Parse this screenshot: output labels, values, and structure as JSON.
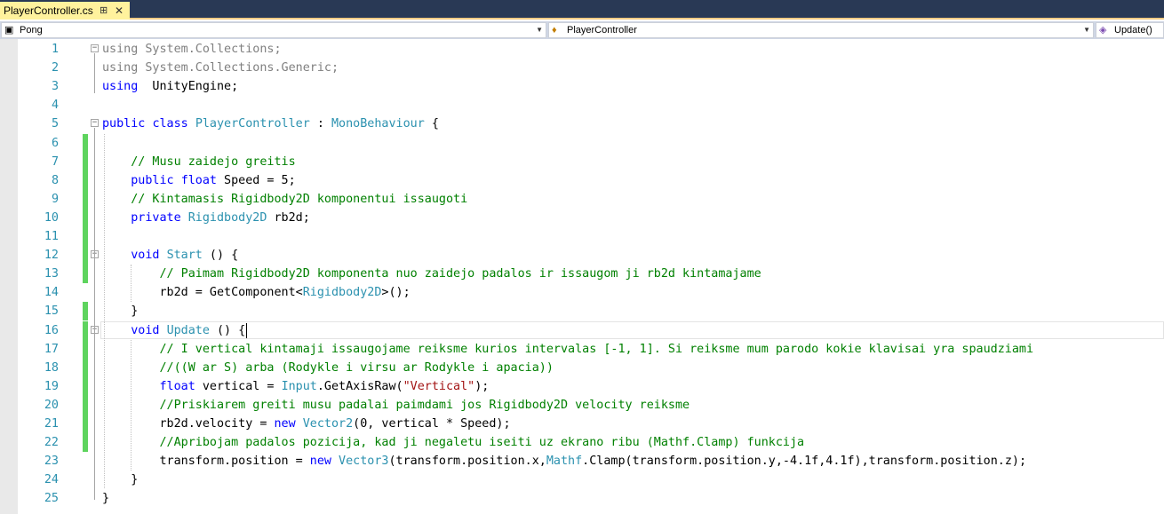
{
  "tab": {
    "title": "PlayerController.cs",
    "pin_icon": "pin-icon",
    "close_icon": "close-icon"
  },
  "nav": {
    "project": "Pong",
    "class": "PlayerController",
    "member": "Update()"
  },
  "editor": {
    "caret_line": 16,
    "lines": [
      {
        "n": "1",
        "t": [
          [
            "gray",
            "using System.Collections;"
          ]
        ],
        "collapse": "-"
      },
      {
        "n": "2",
        "t": [
          [
            "gray",
            "using System.Collections.Generic;"
          ]
        ]
      },
      {
        "n": "3",
        "t": [
          [
            "kw",
            "using"
          ],
          [
            "",
            "  UnityEngine;"
          ]
        ]
      },
      {
        "n": "4",
        "t": []
      },
      {
        "n": "5",
        "t": [
          [
            "kw",
            "public"
          ],
          [
            "",
            " "
          ],
          [
            "kw",
            "class"
          ],
          [
            "",
            " "
          ],
          [
            "ty",
            "PlayerController"
          ],
          [
            "",
            " : "
          ],
          [
            "ty",
            "MonoBehaviour"
          ],
          [
            "",
            " {"
          ]
        ],
        "collapse": "-"
      },
      {
        "n": "6",
        "t": [],
        "changed": true
      },
      {
        "n": "7",
        "t": [
          [
            "",
            "    "
          ],
          [
            "cm",
            "// Musu zaidejo greitis"
          ]
        ],
        "changed": true
      },
      {
        "n": "8",
        "t": [
          [
            "",
            "    "
          ],
          [
            "kw",
            "public"
          ],
          [
            "",
            " "
          ],
          [
            "kw",
            "float"
          ],
          [
            "",
            " Speed = 5;"
          ]
        ],
        "changed": true
      },
      {
        "n": "9",
        "t": [
          [
            "",
            "    "
          ],
          [
            "cm",
            "// Kintamasis Rigidbody2D komponentui issaugoti"
          ]
        ],
        "changed": true
      },
      {
        "n": "10",
        "t": [
          [
            "",
            "    "
          ],
          [
            "kw",
            "private"
          ],
          [
            "",
            " "
          ],
          [
            "ty",
            "Rigidbody2D"
          ],
          [
            "",
            " rb2d;"
          ]
        ],
        "changed": true
      },
      {
        "n": "11",
        "t": [],
        "changed": true
      },
      {
        "n": "12",
        "t": [
          [
            "",
            "    "
          ],
          [
            "kw",
            "void"
          ],
          [
            "",
            " "
          ],
          [
            "ty",
            "Start"
          ],
          [
            "",
            " () {"
          ]
        ],
        "changed": true,
        "collapse": "-"
      },
      {
        "n": "13",
        "t": [
          [
            "",
            "        "
          ],
          [
            "cm",
            "// Paimam Rigidbody2D komponenta nuo zaidejo padalos ir issaugom ji rb2d kintamajame"
          ]
        ],
        "changed": true
      },
      {
        "n": "14",
        "t": [
          [
            "",
            "        rb2d = GetComponent<"
          ],
          [
            "ty",
            "Rigidbody2D"
          ],
          [
            "",
            ">();"
          ]
        ]
      },
      {
        "n": "15",
        "t": [
          [
            "",
            "    }"
          ]
        ],
        "changed": true
      },
      {
        "n": "16",
        "t": [
          [
            "",
            "    "
          ],
          [
            "kw",
            "void"
          ],
          [
            "",
            " "
          ],
          [
            "ty",
            "Update"
          ],
          [
            "",
            " () {"
          ]
        ],
        "changed": true,
        "collapse": "-"
      },
      {
        "n": "17",
        "t": [
          [
            "",
            "        "
          ],
          [
            "cm",
            "// I vertical kintamaji issaugojame reiksme kurios intervalas [-1, 1]. Si reiksme mum parodo kokie klavisai yra spaudziami"
          ]
        ],
        "changed": true
      },
      {
        "n": "18",
        "t": [
          [
            "",
            "        "
          ],
          [
            "cm",
            "//((W ar S) arba (Rodykle i virsu ar Rodykle i apacia))"
          ]
        ],
        "changed": true
      },
      {
        "n": "19",
        "t": [
          [
            "",
            "        "
          ],
          [
            "kw",
            "float"
          ],
          [
            "",
            " vertical = "
          ],
          [
            "ty",
            "Input"
          ],
          [
            "",
            ".GetAxisRaw("
          ],
          [
            "st",
            "\"Vertical\""
          ],
          [
            "",
            ");"
          ]
        ],
        "changed": true
      },
      {
        "n": "20",
        "t": [
          [
            "",
            "        "
          ],
          [
            "cm",
            "//Priskiarem greiti musu padalai paimdami jos Rigidbody2D velocity reiksme"
          ]
        ],
        "changed": true
      },
      {
        "n": "21",
        "t": [
          [
            "",
            "        rb2d.velocity = "
          ],
          [
            "kw",
            "new"
          ],
          [
            "",
            " "
          ],
          [
            "ty",
            "Vector2"
          ],
          [
            "",
            "(0, vertical * Speed);"
          ]
        ],
        "changed": true
      },
      {
        "n": "22",
        "t": [
          [
            "",
            "        "
          ],
          [
            "cm",
            "//Apribojam padalos pozicija, kad ji negaletu iseiti uz ekrano ribu (Mathf.Clamp) funkcija"
          ]
        ],
        "changed": true
      },
      {
        "n": "23",
        "t": [
          [
            "",
            "        transform.position = "
          ],
          [
            "kw",
            "new"
          ],
          [
            "",
            " "
          ],
          [
            "ty",
            "Vector3"
          ],
          [
            "",
            "(transform.position.x,"
          ],
          [
            "ty",
            "Mathf"
          ],
          [
            "",
            ".Clamp(transform.position.y,-4.1f,4.1f),transform.position.z);"
          ]
        ]
      },
      {
        "n": "24",
        "t": [
          [
            "",
            "    }"
          ]
        ]
      },
      {
        "n": "25",
        "t": [
          [
            "",
            "}"
          ]
        ]
      }
    ]
  }
}
